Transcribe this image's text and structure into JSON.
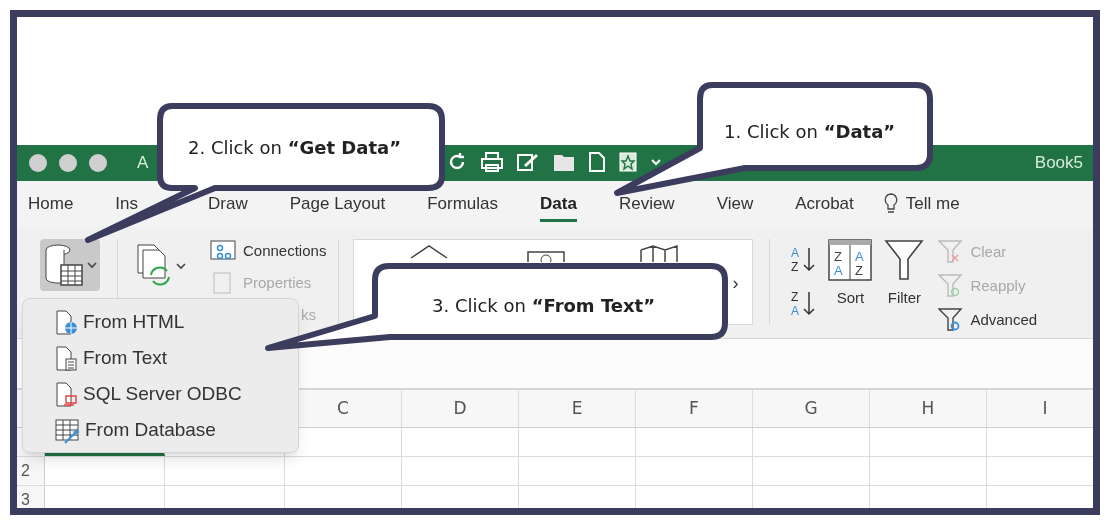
{
  "title_bar": {
    "title_fragment": "A",
    "document": "Book5"
  },
  "tabs": [
    {
      "label": "Home",
      "selected": false
    },
    {
      "label": "Ins",
      "selected": false
    },
    {
      "label": "Draw",
      "selected": false
    },
    {
      "label": "Page Layout",
      "selected": false
    },
    {
      "label": "Formulas",
      "selected": false
    },
    {
      "label": "Data",
      "selected": true
    },
    {
      "label": "Review",
      "selected": false
    },
    {
      "label": "View",
      "selected": false
    },
    {
      "label": "Acrobat",
      "selected": false
    }
  ],
  "tell_me": "Tell me",
  "ribbon": {
    "queries": [
      {
        "label": "Connections",
        "disabled": false
      },
      {
        "label": "Properties",
        "disabled": true
      },
      {
        "label": "ks",
        "disabled": true
      }
    ],
    "gallery_more": "›",
    "sort": "Sort",
    "filter": "Filter",
    "sort_ascending_letters": [
      "A",
      "Z"
    ],
    "sort_descending_letters": [
      "Z",
      "A"
    ],
    "sort_dialog_letters": [
      "Z",
      "A",
      "A",
      "Z"
    ],
    "filter_commands": [
      {
        "label": "Clear",
        "disabled": true
      },
      {
        "label": "Reapply",
        "disabled": true
      },
      {
        "label": "Advanced",
        "disabled": false
      }
    ]
  },
  "get_data_menu": [
    {
      "label": "From HTML",
      "kind": "html"
    },
    {
      "label": "From Text",
      "kind": "text"
    },
    {
      "label": "SQL Server ODBC",
      "kind": "odbc"
    },
    {
      "label": "From Database",
      "kind": "database"
    }
  ],
  "columns": [
    "C",
    "D",
    "E",
    "F",
    "G",
    "H",
    "I"
  ],
  "rows": [
    "2",
    "3"
  ],
  "callouts": [
    {
      "text": "1. Click on **“Data”**"
    },
    {
      "text": "2. Click on **“Get Data”**"
    },
    {
      "text": "3. Click on **“From Text”**"
    }
  ]
}
